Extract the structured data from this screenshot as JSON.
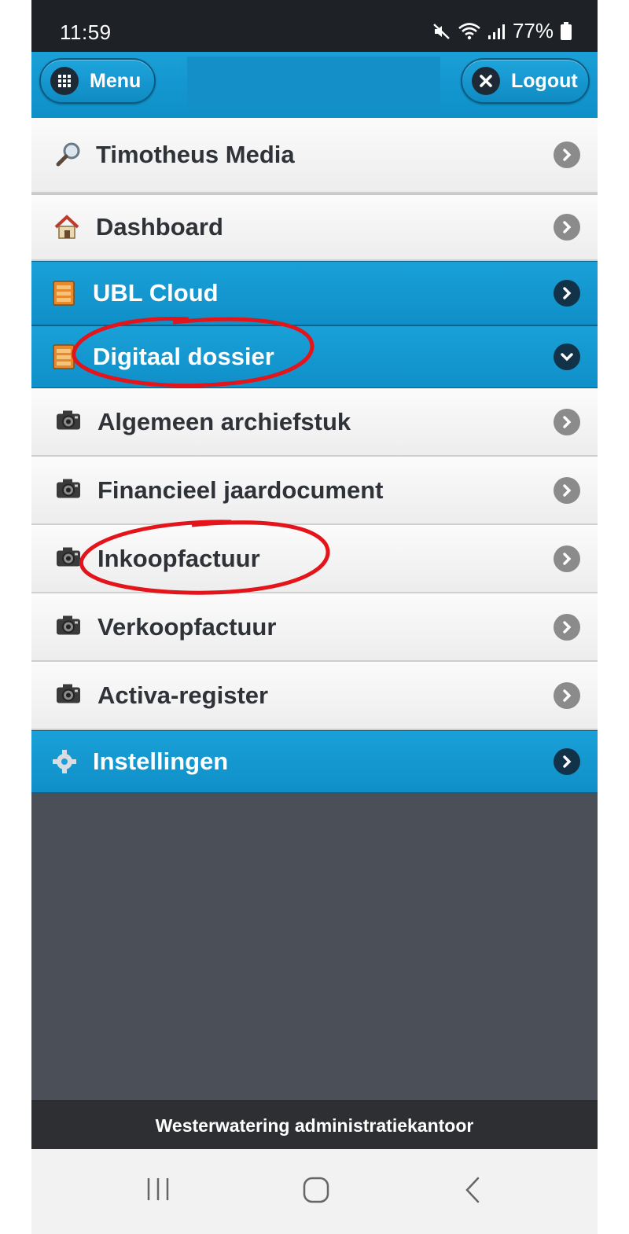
{
  "status_bar": {
    "time": "11:59",
    "battery": "77%",
    "icons": [
      "mute-icon",
      "wifi-icon",
      "signal-icon",
      "battery-icon"
    ]
  },
  "header": {
    "menu_label": "Menu",
    "logout_label": "Logout"
  },
  "menu": {
    "top": {
      "label": "Timotheus Media",
      "icon": "magnifier-icon"
    },
    "dashboard": {
      "label": "Dashboard",
      "icon": "house-icon"
    },
    "ubl": {
      "label": "UBL Cloud",
      "icon": "cabinet-icon"
    },
    "dossier": {
      "label": "Digitaal dossier",
      "icon": "cabinet-icon",
      "expanded": true
    },
    "sub": [
      {
        "label": "Algemeen archiefstuk",
        "icon": "camera-icon"
      },
      {
        "label": "Financieel jaardocument",
        "icon": "camera-icon"
      },
      {
        "label": "Inkoopfactuur",
        "icon": "camera-icon"
      },
      {
        "label": "Verkoopfactuur",
        "icon": "camera-icon"
      },
      {
        "label": "Activa-register",
        "icon": "camera-icon"
      }
    ],
    "settings": {
      "label": "Instellingen",
      "icon": "gear-icon"
    }
  },
  "footer": {
    "text": "Westerwatering administratiekantoor"
  },
  "colors": {
    "accent": "#1a9fd7",
    "annotation": "#e3141a",
    "background": "#4b4f57"
  }
}
